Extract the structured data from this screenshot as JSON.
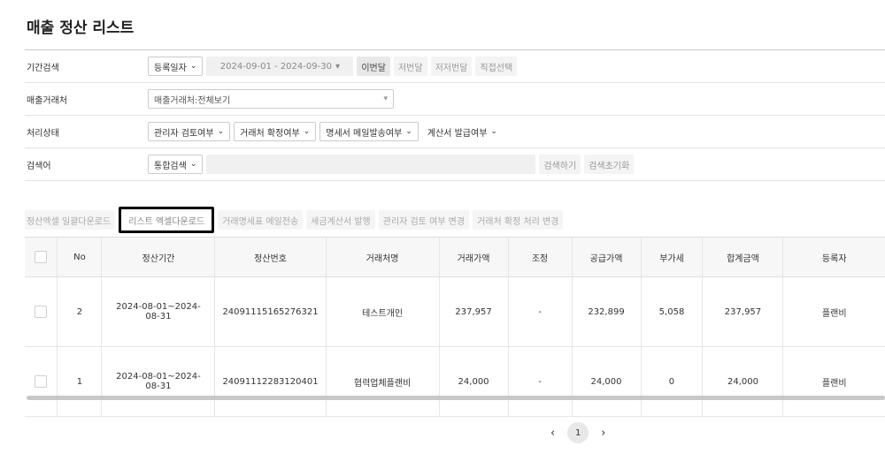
{
  "page_title": "매출 정산 리스트",
  "filters": {
    "period": {
      "label": "기간검색",
      "type_select": "등록일자",
      "date_range": "2024-09-01 - 2024-09-30",
      "quick": [
        "이번달",
        "저번달",
        "저저번달",
        "직접선택"
      ]
    },
    "client": {
      "label": "매출거래처",
      "select": "매출거래처:전체보기"
    },
    "status": {
      "label": "처리상태",
      "selects": [
        "관리자 검토여부",
        "거래처 확정여부",
        "명세서 메일발송여부",
        "계산서 발급여부"
      ]
    },
    "keyword": {
      "label": "검색어",
      "type_select": "통합검색",
      "input_value": "",
      "search_button": "검색하기",
      "reset_button": "검색초기화"
    }
  },
  "actions": [
    "정산엑셀 일괄다운로드",
    "리스트 엑셀다운로드",
    "거래명세표 메일전송",
    "세금계산서 발행",
    "관리자 검토 여부 변경",
    "거래처 확정 처리 변경"
  ],
  "table": {
    "columns": [
      "No",
      "정산기간",
      "정산번호",
      "거래처명",
      "거래가액",
      "조정",
      "공급가액",
      "부가세",
      "합계금액",
      "등록자"
    ],
    "rows": [
      [
        "2",
        "2024-08-01~2024-08-31",
        "24091115165276321",
        "테스트개인",
        "237,957",
        "-",
        "232,899",
        "5,058",
        "237,957",
        "플랜비"
      ],
      [
        "1",
        "2024-08-01~2024-08-31",
        "24091112283120401",
        "협력업체플랜비",
        "24,000",
        "-",
        "24,000",
        "0",
        "24,000",
        "플랜비"
      ]
    ]
  },
  "pagination": {
    "prev": "‹",
    "current": "1",
    "next": "›"
  }
}
